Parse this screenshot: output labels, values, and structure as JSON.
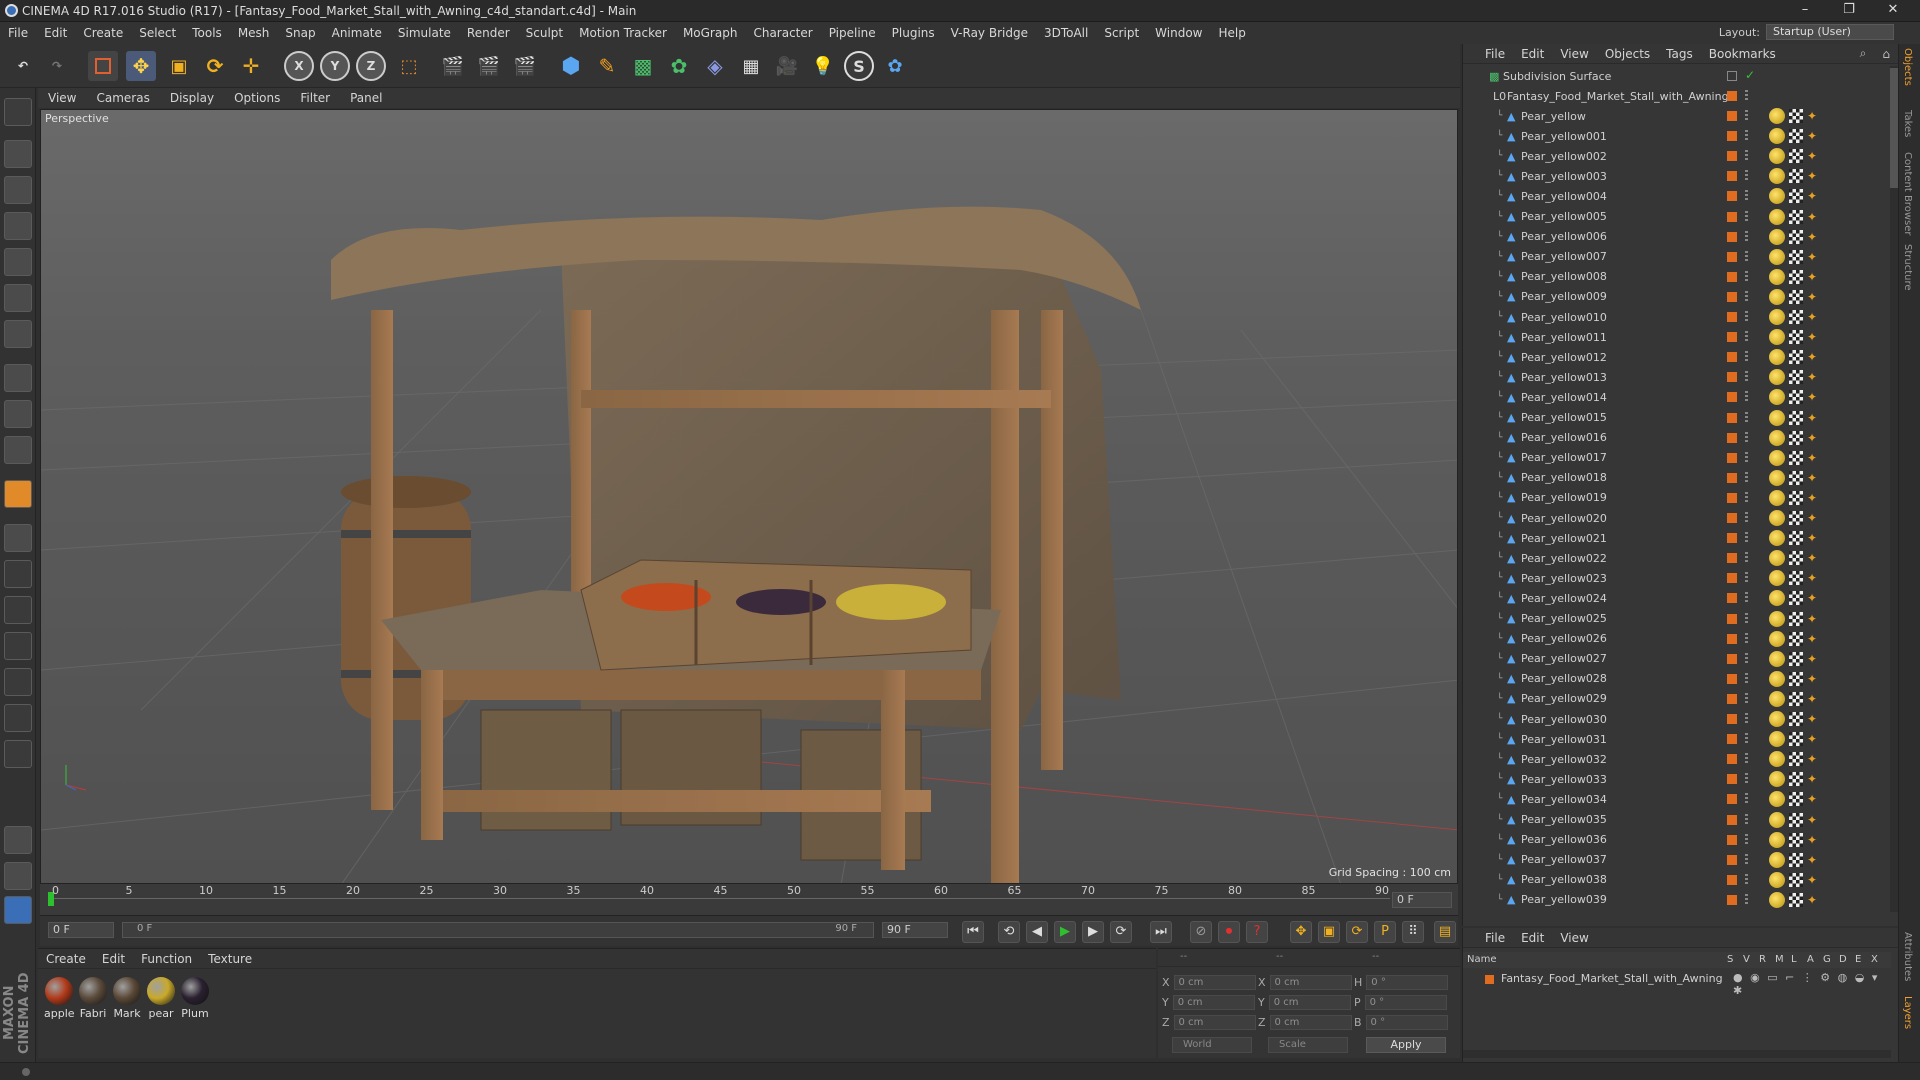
{
  "window": {
    "title": "CINEMA 4D R17.016 Studio (R17) - [Fantasy_Food_Market_Stall_with_Awning_c4d_standart.c4d] - Main"
  },
  "menu": [
    "File",
    "Edit",
    "Create",
    "Select",
    "Tools",
    "Mesh",
    "Snap",
    "Animate",
    "Simulate",
    "Render",
    "Sculpt",
    "Motion Tracker",
    "MoGraph",
    "Character",
    "Pipeline",
    "Plugins",
    "V-Ray Bridge",
    "3DToAll",
    "Script",
    "Window",
    "Help"
  ],
  "layout": {
    "label": "Layout:",
    "value": "Startup (User)"
  },
  "viewport": {
    "menu": [
      "View",
      "Cameras",
      "Display",
      "Options",
      "Filter",
      "Panel"
    ],
    "label": "Perspective",
    "grid_spacing": "Grid Spacing : 100 cm"
  },
  "timeline": {
    "ticks": [
      "0",
      "5",
      "10",
      "15",
      "20",
      "25",
      "30",
      "35",
      "40",
      "45",
      "50",
      "55",
      "60",
      "65",
      "70",
      "75",
      "80",
      "85",
      "90"
    ],
    "end_frame": "0 F",
    "current": "0 F",
    "range_start": "0 F",
    "range_end": "90 F",
    "max": "90 F"
  },
  "materials": {
    "menu": [
      "Create",
      "Edit",
      "Function",
      "Texture"
    ],
    "items": [
      {
        "name": "apple",
        "color": "#b23a1a"
      },
      {
        "name": "Fabri",
        "color": "#5a4a3a"
      },
      {
        "name": "Mark",
        "color": "#5a4836"
      },
      {
        "name": "pear",
        "color": "#c9a92a"
      },
      {
        "name": "Plum",
        "color": "#2a2030"
      }
    ]
  },
  "coords": {
    "col1": [
      {
        "axis": "X",
        "val": "0 cm"
      },
      {
        "axis": "Y",
        "val": "0 cm"
      },
      {
        "axis": "Z",
        "val": "0 cm"
      }
    ],
    "col2": [
      {
        "axis": "X",
        "val": "0 cm"
      },
      {
        "axis": "Y",
        "val": "0 cm"
      },
      {
        "axis": "Z",
        "val": "0 cm"
      }
    ],
    "col3": [
      {
        "axis": "H",
        "val": "0 °"
      },
      {
        "axis": "P",
        "val": "0 °"
      },
      {
        "axis": "B",
        "val": "0 °"
      }
    ],
    "mode1": "World",
    "mode2": "Scale",
    "apply": "Apply",
    "dashes": [
      "--",
      "--",
      "--"
    ]
  },
  "objects": {
    "menu": [
      "File",
      "Edit",
      "View",
      "Objects",
      "Tags",
      "Bookmarks"
    ],
    "root": "Subdivision Surface",
    "group": "Fantasy_Food_Market_Stall_with_Awning",
    "items": [
      "Pear_yellow",
      "Pear_yellow001",
      "Pear_yellow002",
      "Pear_yellow003",
      "Pear_yellow004",
      "Pear_yellow005",
      "Pear_yellow006",
      "Pear_yellow007",
      "Pear_yellow008",
      "Pear_yellow009",
      "Pear_yellow010",
      "Pear_yellow011",
      "Pear_yellow012",
      "Pear_yellow013",
      "Pear_yellow014",
      "Pear_yellow015",
      "Pear_yellow016",
      "Pear_yellow017",
      "Pear_yellow018",
      "Pear_yellow019",
      "Pear_yellow020",
      "Pear_yellow021",
      "Pear_yellow022",
      "Pear_yellow023",
      "Pear_yellow024",
      "Pear_yellow025",
      "Pear_yellow026",
      "Pear_yellow027",
      "Pear_yellow028",
      "Pear_yellow029",
      "Pear_yellow030",
      "Pear_yellow031",
      "Pear_yellow032",
      "Pear_yellow033",
      "Pear_yellow034",
      "Pear_yellow035",
      "Pear_yellow036",
      "Pear_yellow037",
      "Pear_yellow038",
      "Pear_yellow039"
    ]
  },
  "layers": {
    "menu": [
      "File",
      "Edit",
      "View"
    ],
    "header_name": "Name",
    "header_cols": [
      "S",
      "V",
      "R",
      "M",
      "L",
      "A",
      "G",
      "D",
      "E",
      "X"
    ],
    "row": "Fantasy_Food_Market_Stall_with_Awning"
  },
  "side_tabs": [
    "Objects",
    "Takes",
    "Content Browser",
    "Structure"
  ],
  "side_tabs_lower": [
    "Attributes",
    "Layers"
  ],
  "brand": "MAXON CINEMA 4D"
}
